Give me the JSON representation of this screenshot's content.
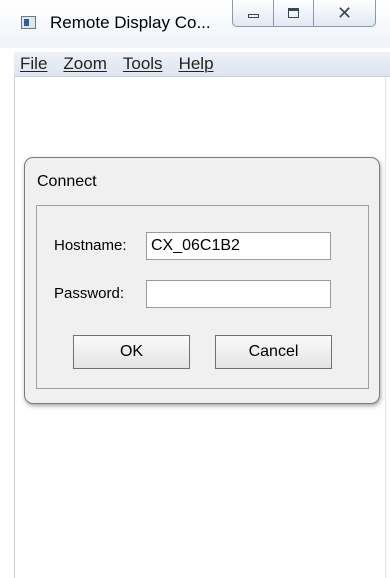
{
  "window": {
    "title": "Remote Display Co...",
    "icon": "app-window-icon",
    "caption": {
      "minimize_icon": "minimize-icon",
      "maximize_icon": "maximize-icon",
      "close_glyph": "✕"
    }
  },
  "menu": {
    "items": [
      {
        "label": "File"
      },
      {
        "label": "Zoom"
      },
      {
        "label": "Tools"
      },
      {
        "label": "Help"
      }
    ]
  },
  "dialog": {
    "title": "Connect",
    "hostname_label": "Hostname:",
    "hostname_value": "CX_06C1B2",
    "password_label": "Password:",
    "password_value": "",
    "ok_label": "OK",
    "cancel_label": "Cancel"
  }
}
